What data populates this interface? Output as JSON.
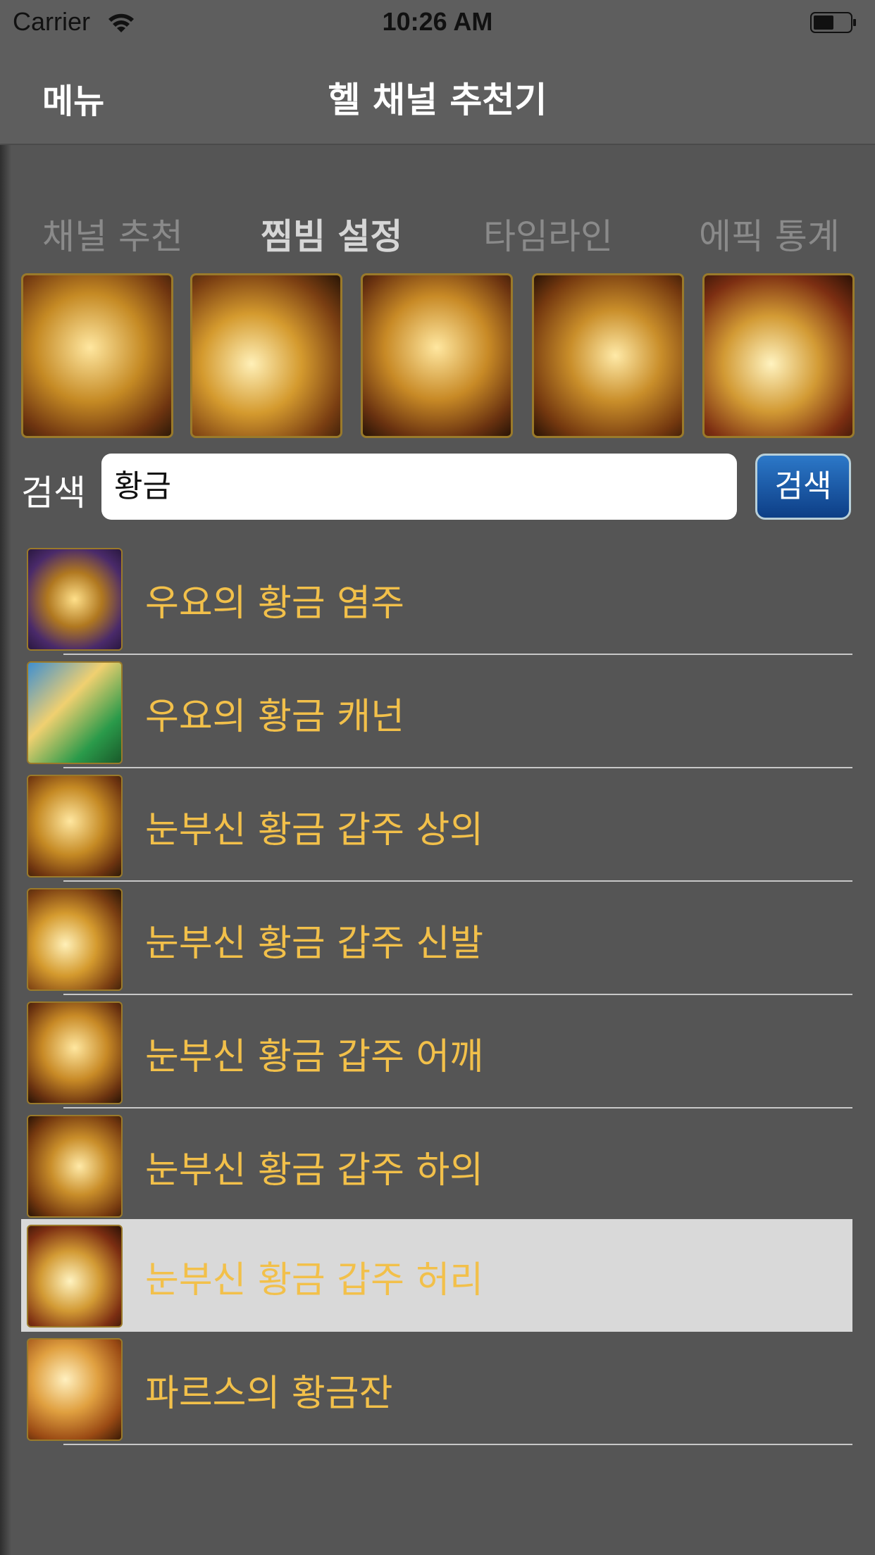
{
  "status_bar": {
    "carrier": "Carrier",
    "time": "10:26 AM"
  },
  "nav": {
    "menu_label": "메뉴",
    "title": "헬 채널 추천기"
  },
  "tabs": [
    {
      "label": "채널 추천",
      "active": false
    },
    {
      "label": "찜빔 설정",
      "active": true
    },
    {
      "label": "타임라인",
      "active": false
    },
    {
      "label": "에픽 통계",
      "active": false
    }
  ],
  "equipment_slots": [
    "gold-armor-top-icon",
    "gold-boots-icon",
    "gold-shoulder-icon",
    "gold-pants-icon",
    "gold-belt-icon"
  ],
  "search": {
    "label": "검색",
    "query": "황금",
    "button_label": "검색"
  },
  "results": [
    {
      "name": "우요의 황금 염주",
      "icon": "gold-rosary-icon",
      "selected": false
    },
    {
      "name": "우요의 황금 캐넌",
      "icon": "gold-cannon-icon",
      "selected": false
    },
    {
      "name": "눈부신 황금 갑주 상의",
      "icon": "gold-armor-top-icon",
      "selected": false
    },
    {
      "name": "눈부신 황금 갑주 신발",
      "icon": "gold-boots-icon",
      "selected": false
    },
    {
      "name": "눈부신 황금 갑주 어깨",
      "icon": "gold-shoulder-icon",
      "selected": false
    },
    {
      "name": "눈부신 황금 갑주 하의",
      "icon": "gold-pants-icon",
      "selected": false
    },
    {
      "name": "눈부신 황금 갑주 허리",
      "icon": "gold-belt-icon",
      "selected": true
    },
    {
      "name": "파르스의 황금잔",
      "icon": "gold-cup-icon",
      "selected": false
    }
  ],
  "colors": {
    "background": "#555555",
    "item_text": "#f2c04a",
    "selected_row": "#d9d9d9",
    "button_blue": "#0d3e86"
  }
}
